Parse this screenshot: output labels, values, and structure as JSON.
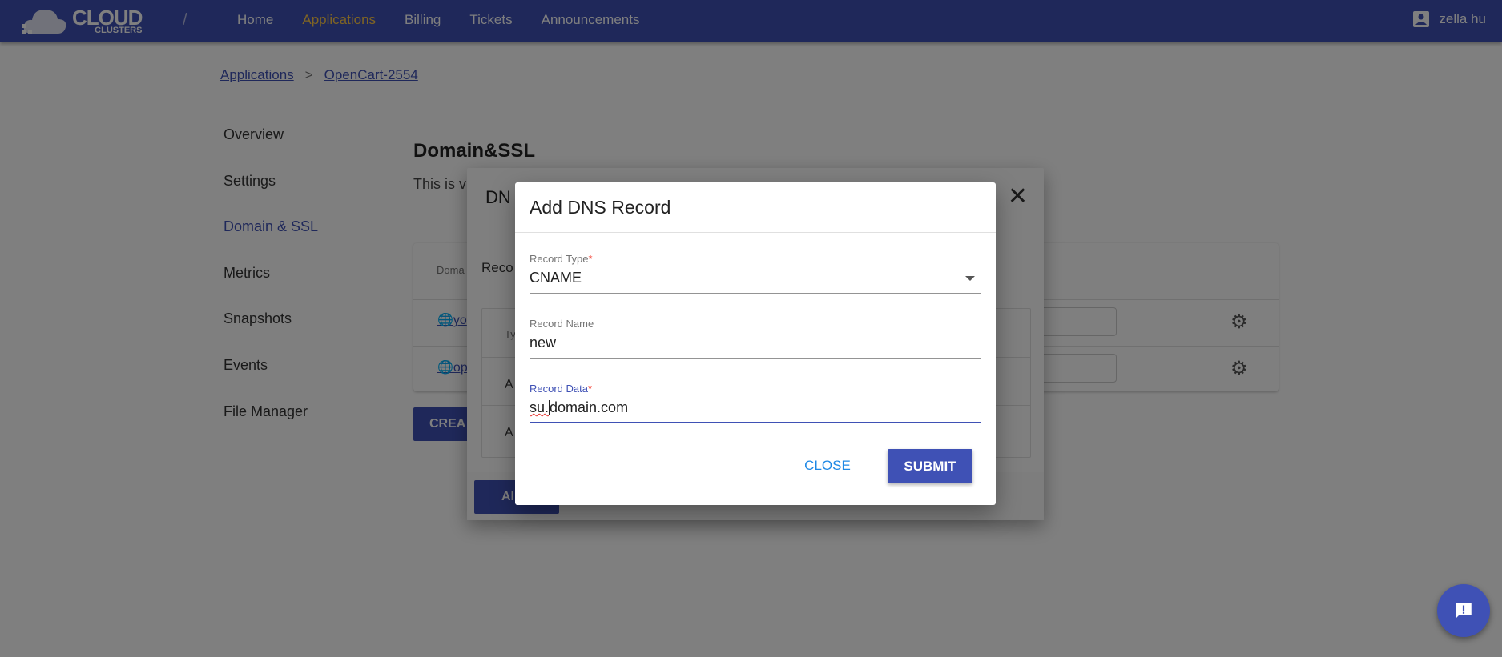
{
  "brand": {
    "line1": "CLOUD",
    "line2": "CLUSTERS"
  },
  "nav": {
    "items": [
      "Home",
      "Applications",
      "Billing",
      "Tickets",
      "Announcements"
    ],
    "active": "Applications"
  },
  "user": {
    "name": "zella hu"
  },
  "breadcrumb": {
    "items": [
      "Applications",
      "OpenCart-2554"
    ],
    "separator": ">"
  },
  "sidebar": {
    "items": [
      "Overview",
      "Settings",
      "Domain & SSL",
      "Metrics",
      "Snapshots",
      "Events",
      "File Manager"
    ],
    "active": "Domain & SSL"
  },
  "page": {
    "title": "Domain&SSL",
    "subtitle_partial": "This is v",
    "table": {
      "header_partial": "Doma",
      "rows": [
        "yo",
        "op"
      ]
    },
    "create_label_partial": "CREA"
  },
  "outer_dialog": {
    "title_partial": "DN",
    "records_label_partial": "Reco",
    "table": {
      "header_partial": "Ty",
      "rows": [
        "A",
        "A"
      ]
    },
    "add_label_partial": "Al"
  },
  "dialog": {
    "title": "Add DNS Record",
    "fields": {
      "record_type": {
        "label": "Record Type",
        "required_mark": "*",
        "value": "CNAME"
      },
      "record_name": {
        "label": "Record Name",
        "value": "new"
      },
      "record_data": {
        "label": "Record Data",
        "required_mark": "*",
        "value_a": "su.",
        "value_b": "domain.com"
      }
    },
    "close_label": "CLOSE",
    "submit_label": "SUBMIT"
  },
  "colors": {
    "primary": "#3f51b5",
    "accent_nav": "#ffc947",
    "link_blue": "#1e88e5",
    "required": "#f44336"
  }
}
